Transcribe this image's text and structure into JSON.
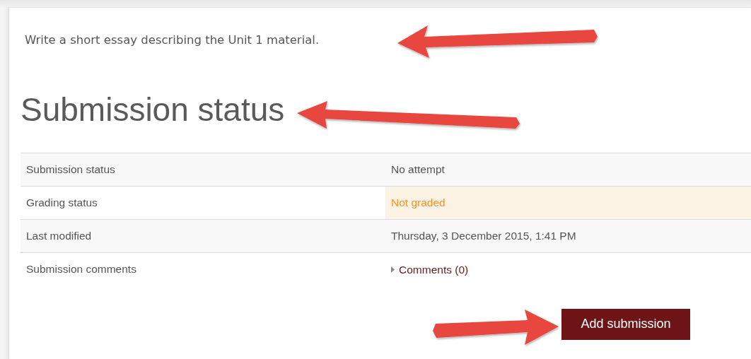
{
  "intro": "Write a short essay describing the Unit 1 material.",
  "heading": "Submission status",
  "rows": [
    {
      "label": "Submission status",
      "value": "No attempt",
      "kind": "text",
      "highlight": false
    },
    {
      "label": "Grading status",
      "value": "Not graded",
      "kind": "text",
      "highlight": true
    },
    {
      "label": "Last modified",
      "value": "Thursday, 3 December 2015, 1:41 PM",
      "kind": "text",
      "highlight": false
    },
    {
      "label": "Submission comments",
      "value": "Comments (0)",
      "kind": "link",
      "highlight": false
    }
  ],
  "button": "Add submission"
}
